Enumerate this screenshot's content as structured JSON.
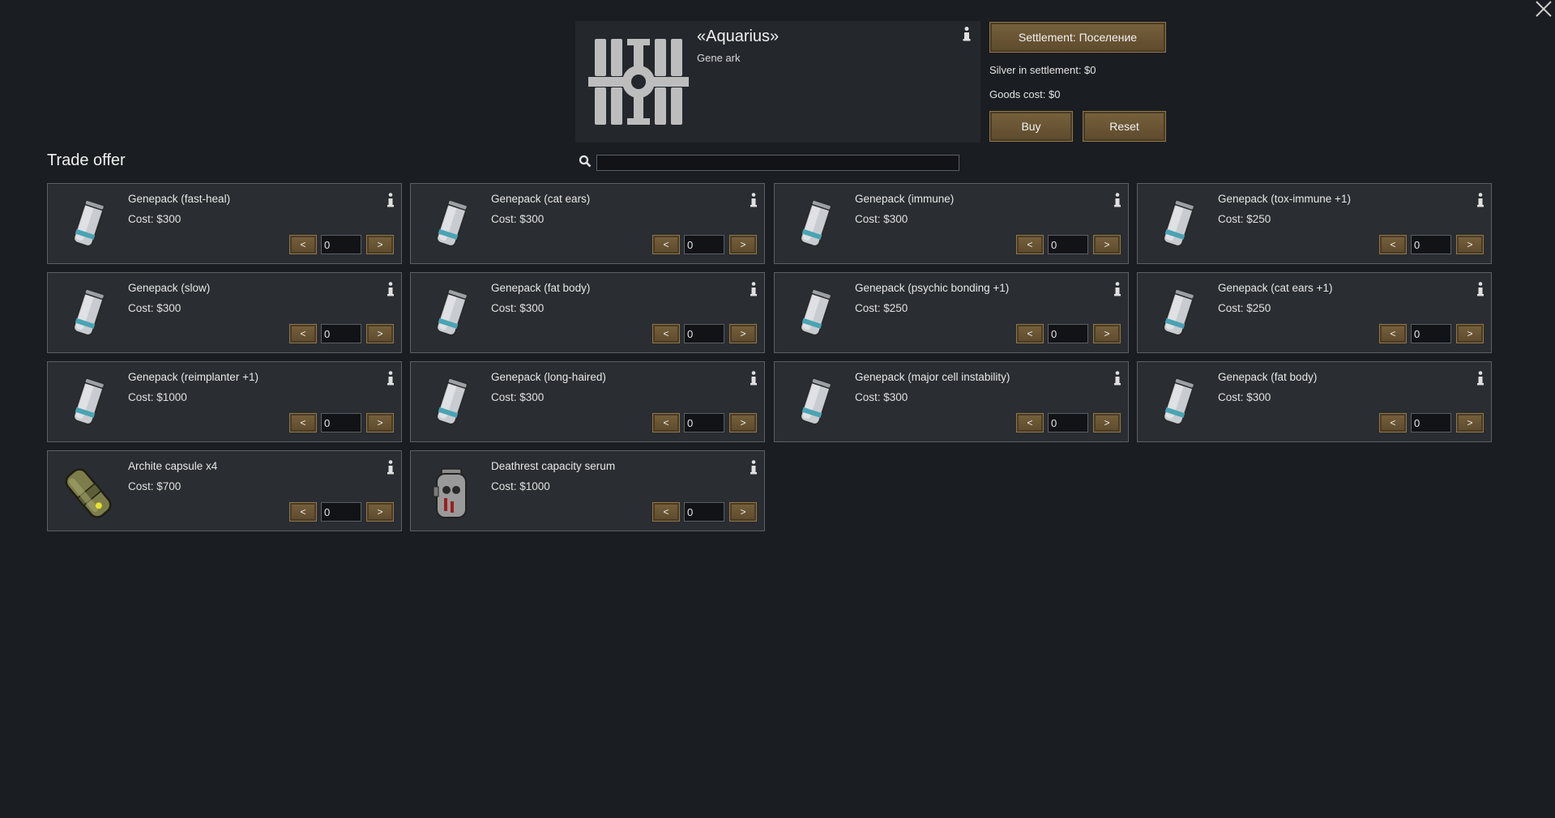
{
  "trader": {
    "name": "«Aquarius»",
    "type": "Gene ark",
    "icon": "space-station-icon"
  },
  "settlement_button": "Settlement: Поселение",
  "silver_in_settlement": "Silver in settlement: $0",
  "goods_cost": "Goods cost: $0",
  "buy_label": "Buy",
  "reset_label": "Reset",
  "section_title": "Trade offer",
  "search": {
    "value": "",
    "placeholder": ""
  },
  "items": [
    {
      "name": "Genepack (fast-heal)",
      "cost": "Cost: $300",
      "qty": "0",
      "icon": "genepack-icon"
    },
    {
      "name": "Genepack (cat ears)",
      "cost": "Cost: $300",
      "qty": "0",
      "icon": "genepack-icon"
    },
    {
      "name": "Genepack (immune)",
      "cost": "Cost: $300",
      "qty": "0",
      "icon": "genepack-icon"
    },
    {
      "name": "Genepack (tox-immune +1)",
      "cost": "Cost: $250",
      "qty": "0",
      "icon": "genepack-icon"
    },
    {
      "name": "Genepack (slow)",
      "cost": "Cost: $300",
      "qty": "0",
      "icon": "genepack-icon"
    },
    {
      "name": "Genepack (fat body)",
      "cost": "Cost: $300",
      "qty": "0",
      "icon": "genepack-icon"
    },
    {
      "name": "Genepack (psychic bonding +1)",
      "cost": "Cost: $250",
      "qty": "0",
      "icon": "genepack-icon"
    },
    {
      "name": "Genepack (cat ears +1)",
      "cost": "Cost: $250",
      "qty": "0",
      "icon": "genepack-icon"
    },
    {
      "name": "Genepack (reimplanter +1)",
      "cost": "Cost: $1000",
      "qty": "0",
      "icon": "genepack-icon"
    },
    {
      "name": "Genepack (long-haired)",
      "cost": "Cost: $300",
      "qty": "0",
      "icon": "genepack-icon"
    },
    {
      "name": "Genepack (major cell instability)",
      "cost": "Cost: $300",
      "qty": "0",
      "icon": "genepack-icon"
    },
    {
      "name": "Genepack (fat body)",
      "cost": "Cost: $300",
      "qty": "0",
      "icon": "genepack-icon"
    },
    {
      "name": "Archite capsule x4",
      "cost": "Cost: $700",
      "qty": "0",
      "icon": "archite-capsule-icon"
    },
    {
      "name": "Deathrest capacity serum",
      "cost": "Cost: $1000",
      "qty": "0",
      "icon": "serum-icon"
    }
  ],
  "minus_label": "<",
  "plus_label": ">"
}
